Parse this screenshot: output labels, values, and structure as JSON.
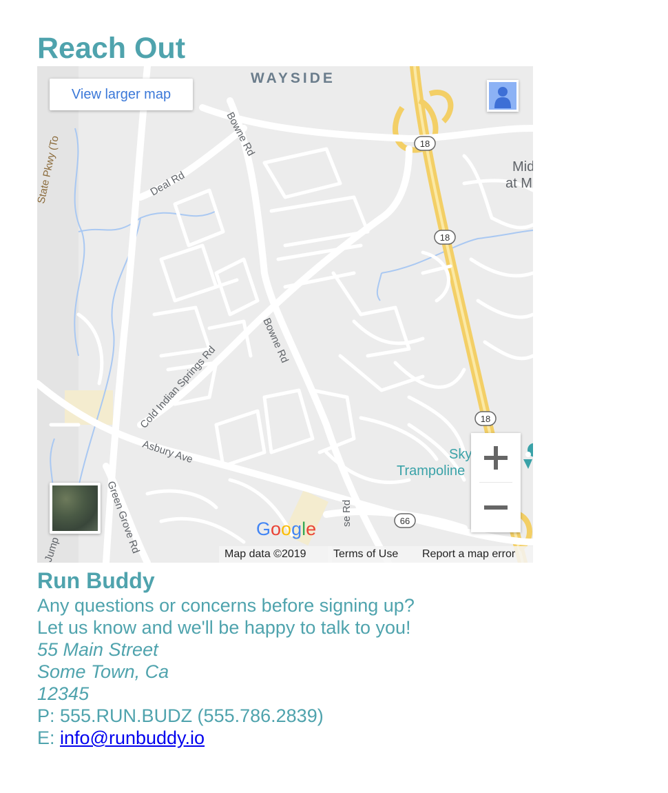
{
  "section": {
    "title": "Reach Out"
  },
  "map": {
    "larger_map_label": "View larger map",
    "area_label": "WAYSIDE",
    "streets": {
      "state_pkwy": "State Pkwy (To",
      "deal_rd": "Deal Rd",
      "bowne_rd_top": "Bowne Rd",
      "bowne_rd_mid": "Bowne Rd",
      "cold_indian": "Cold Indian Springs Rd",
      "asbury": "Asbury Ave",
      "green_grove": "Green Grove Rd",
      "jump": "Jump",
      "bowne_bottom": "se Rd"
    },
    "route_shields": [
      "18",
      "18",
      "18",
      "66"
    ],
    "places": {
      "mid_line1": "Mid",
      "mid_line2": "at M",
      "sky_line1": "Sky",
      "sky_line2": "Trampoline"
    },
    "zoom_in_symbol": "+",
    "zoom_out_symbol": "−",
    "google": [
      "G",
      "o",
      "o",
      "g",
      "l",
      "e"
    ],
    "google_colors": [
      "#4285f4",
      "#ea4335",
      "#fbbc05",
      "#4285f4",
      "#34a853",
      "#ea4335"
    ],
    "attribution": {
      "data": "Map data ©2019",
      "terms": "Terms of Use",
      "report": "Report a map error"
    }
  },
  "contact": {
    "name": "Run Buddy",
    "intro_line1": "Any questions or concerns before signing up?",
    "intro_line2": "Let us know and we'll be happy to talk to you!",
    "address_line1": "55 Main Street",
    "address_line2": "Some Town, Ca",
    "address_line3": "12345",
    "phone": "P: 555.RUN.BUDZ (555.786.2839)",
    "email_prefix": "E: ",
    "email": "info@runbuddy.io"
  },
  "colors": {
    "accent": "#4fa3ad",
    "link": "#0000ee",
    "highway": "#f6d46b",
    "water": "#a9c8f2"
  }
}
